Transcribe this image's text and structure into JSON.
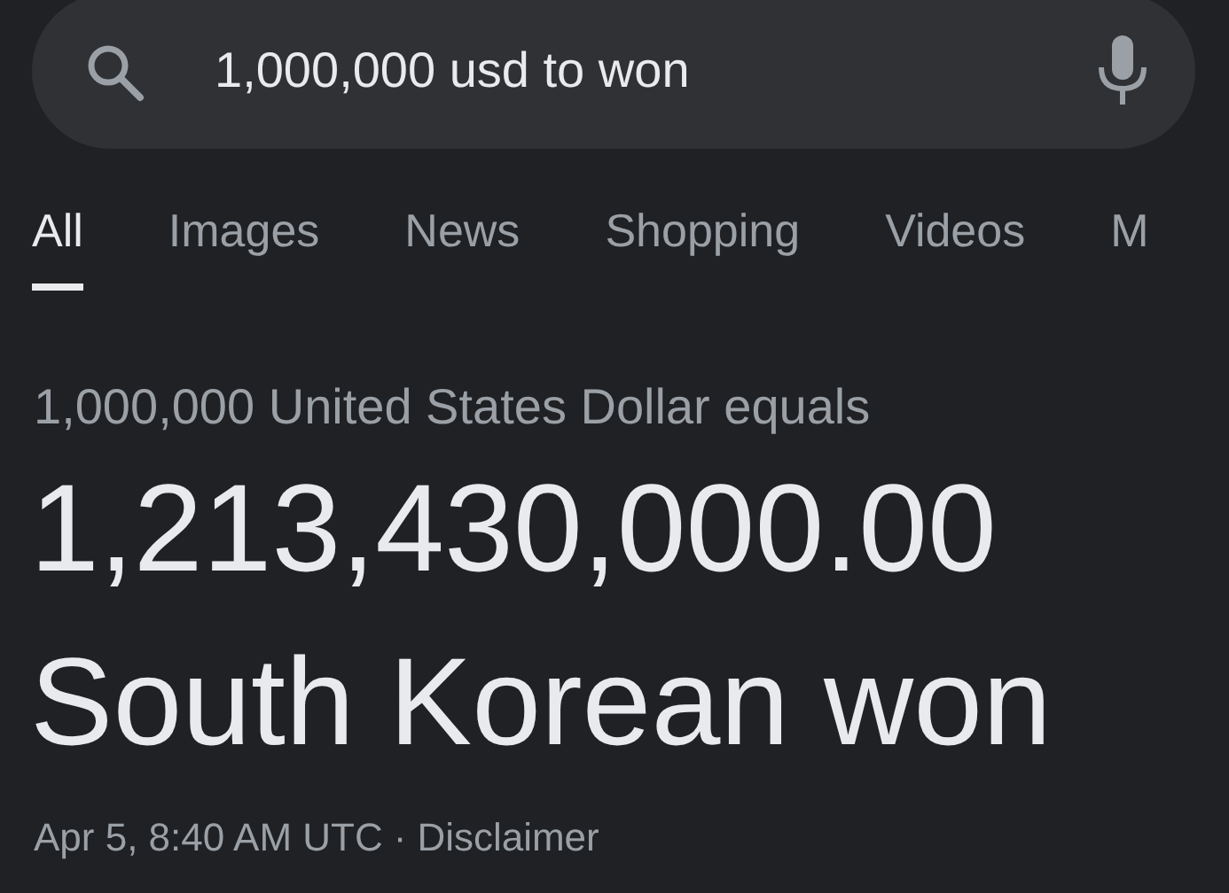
{
  "search": {
    "value": "1,000,000 usd to won"
  },
  "tabs": [
    {
      "label": "All",
      "selected": true
    },
    {
      "label": "Images",
      "selected": false
    },
    {
      "label": "News",
      "selected": false
    },
    {
      "label": "Shopping",
      "selected": false
    },
    {
      "label": "Videos",
      "selected": false
    },
    {
      "label": "M",
      "selected": false
    }
  ],
  "result": {
    "caption": "1,000,000 United States Dollar equals",
    "amount": "1,213,430,000.00",
    "currency": "South Korean won"
  },
  "footer": {
    "timestamp": "Apr 5, 8:40 AM UTC",
    "separator": "·",
    "link": "Disclaimer"
  }
}
